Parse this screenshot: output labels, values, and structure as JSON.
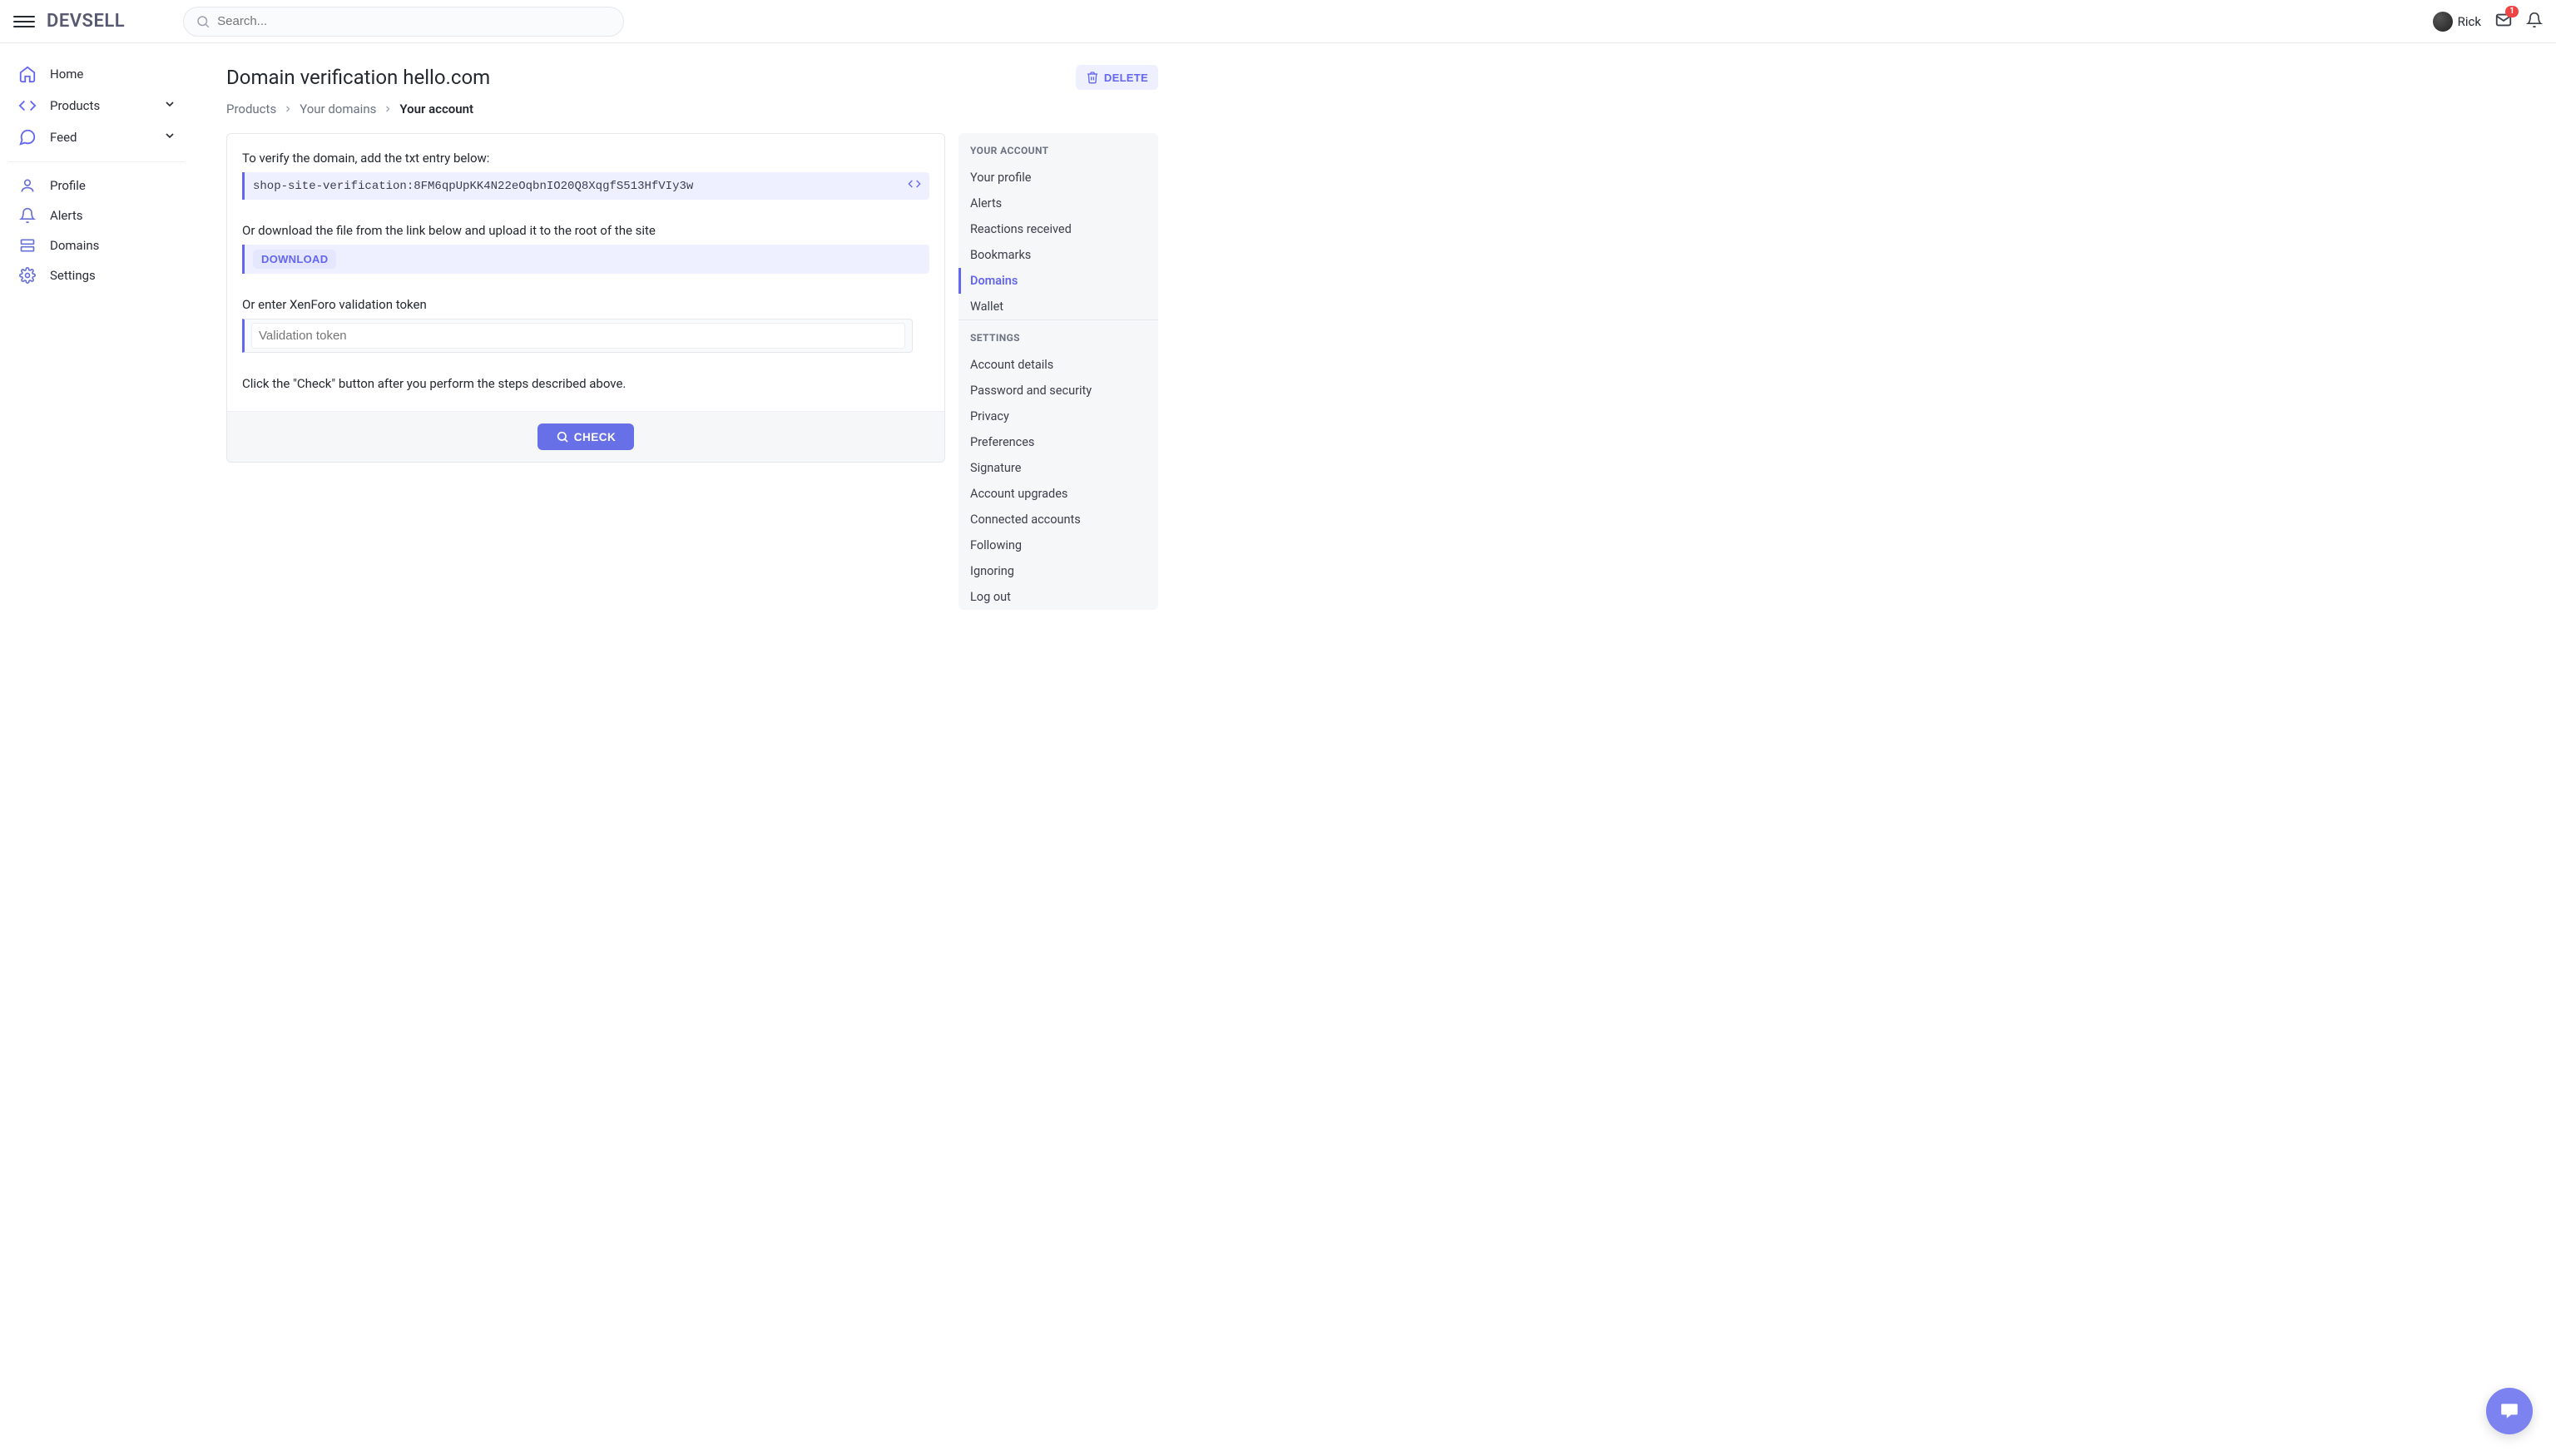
{
  "header": {
    "logo": "DEVSELL",
    "search_placeholder": "Search...",
    "username": "Rick",
    "mail_badge": "1"
  },
  "sidebar": {
    "items": [
      {
        "label": "Home"
      },
      {
        "label": "Products"
      },
      {
        "label": "Feed"
      }
    ],
    "account_items": [
      {
        "label": "Profile"
      },
      {
        "label": "Alerts"
      },
      {
        "label": "Domains"
      },
      {
        "label": "Settings"
      }
    ]
  },
  "page": {
    "title": "Domain verification hello.com",
    "delete_label": "DELETE"
  },
  "breadcrumb": {
    "b0": "Products",
    "b1": "Your domains",
    "b2": "Your account"
  },
  "verify": {
    "txt_label": "To verify the domain, add the txt entry below:",
    "txt_value": "shop-site-verification:8FM6qpUpKK4N22eOqbnIO20Q8XqgfS513HfVIy3w",
    "download_label": "Or download the file from the link below and upload it to the root of the site",
    "download_btn": "DOWNLOAD",
    "token_label": "Or enter XenForo validation token",
    "token_placeholder": "Validation token",
    "check_note": "Click the \"Check\" button after you perform the steps described above.",
    "check_btn": "CHECK"
  },
  "right": {
    "heading1": "YOUR ACCOUNT",
    "links1": [
      "Your profile",
      "Alerts",
      "Reactions received",
      "Bookmarks",
      "Domains",
      "Wallet"
    ],
    "heading2": "SETTINGS",
    "links2": [
      "Account details",
      "Password and security",
      "Privacy",
      "Preferences",
      "Signature",
      "Account upgrades",
      "Connected accounts",
      "Following",
      "Ignoring",
      "Log out"
    ]
  }
}
